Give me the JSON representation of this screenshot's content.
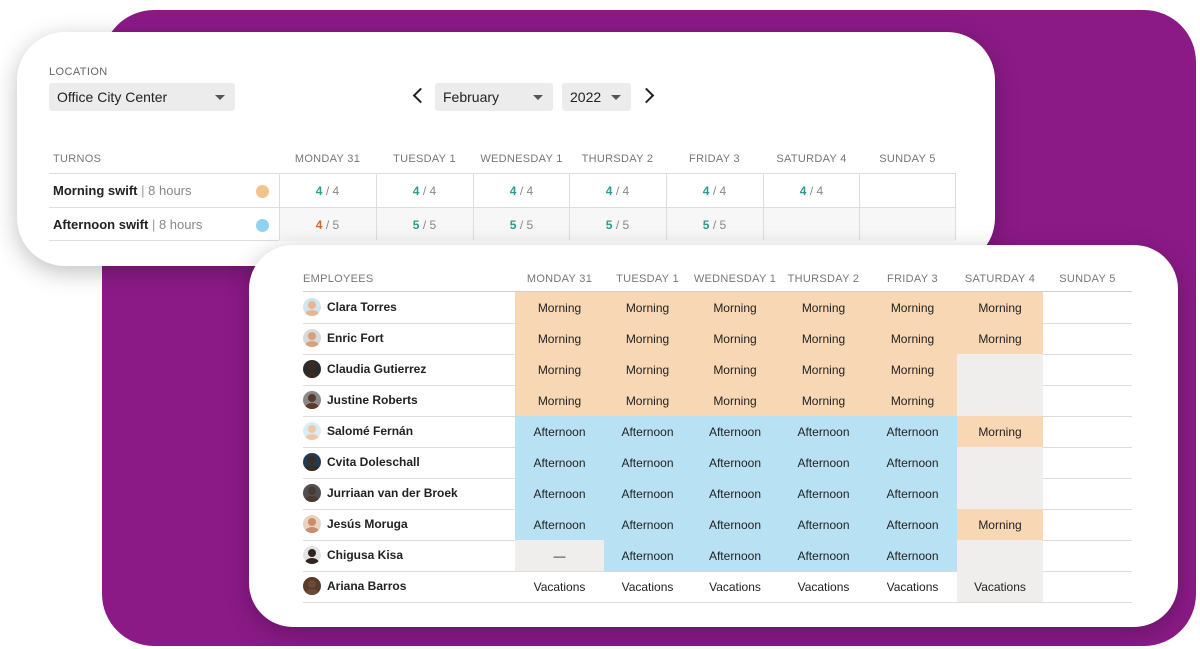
{
  "colors": {
    "morning": "#f8d7b4",
    "afternoon": "#b8e2f4",
    "morning_dot": "#f1c48e",
    "afternoon_dot": "#8fd2ef",
    "accent_green": "#2a9d8f",
    "accent_orange": "#d2691e",
    "brand_bg": "#8b1a87"
  },
  "location": {
    "label": "LOCATION",
    "value": "Office City Center"
  },
  "period": {
    "month": "February",
    "year": "2022"
  },
  "shifts": {
    "header": "TURNOS",
    "days": [
      "MONDAY 31",
      "TUESDAY 1",
      "WEDNESDAY 1",
      "THURSDAY 2",
      "FRIDAY 3",
      "SATURDAY 4",
      "SUNDAY 5"
    ],
    "rows": [
      {
        "name": "Morning swift",
        "sep": "|",
        "hours": "8 hours",
        "counts": [
          {
            "assigned": "4",
            "slash": "/",
            "total": "4",
            "status": "ok"
          },
          {
            "assigned": "4",
            "slash": "/",
            "total": "4",
            "status": "ok"
          },
          {
            "assigned": "4",
            "slash": "/",
            "total": "4",
            "status": "ok"
          },
          {
            "assigned": "4",
            "slash": "/",
            "total": "4",
            "status": "ok"
          },
          {
            "assigned": "4",
            "slash": "/",
            "total": "4",
            "status": "ok"
          },
          {
            "assigned": "4",
            "slash": "/",
            "total": "4",
            "status": "ok"
          },
          null
        ]
      },
      {
        "name": "Afternoon swift",
        "sep": "|",
        "hours": "8 hours",
        "counts": [
          {
            "assigned": "4",
            "slash": "/",
            "total": "5",
            "status": "short"
          },
          {
            "assigned": "5",
            "slash": "/",
            "total": "5",
            "status": "ok"
          },
          {
            "assigned": "5",
            "slash": "/",
            "total": "5",
            "status": "ok"
          },
          {
            "assigned": "5",
            "slash": "/",
            "total": "5",
            "status": "ok"
          },
          {
            "assigned": "5",
            "slash": "/",
            "total": "5",
            "status": "ok"
          },
          null,
          null
        ]
      }
    ]
  },
  "employees": {
    "header": "EMPLOYEES",
    "days": [
      "MONDAY 31",
      "TUESDAY 1",
      "WEDNESDAY 1",
      "THURSDAY 2",
      "FRIDAY 3",
      "SATURDAY 4",
      "SUNDAY 5"
    ],
    "rows": [
      {
        "name": "Clara Torres",
        "cells": [
          "Morning",
          "Morning",
          "Morning",
          "Morning",
          "Morning",
          "Morning",
          ""
        ],
        "types": [
          "m",
          "m",
          "m",
          "m",
          "m",
          "m",
          "n"
        ]
      },
      {
        "name": "Enric Fort",
        "cells": [
          "Morning",
          "Morning",
          "Morning",
          "Morning",
          "Morning",
          "Morning",
          ""
        ],
        "types": [
          "m",
          "m",
          "m",
          "m",
          "m",
          "m",
          "n"
        ]
      },
      {
        "name": "Claudia Gutierrez",
        "cells": [
          "Morning",
          "Morning",
          "Morning",
          "Morning",
          "Morning",
          "",
          ""
        ],
        "types": [
          "m",
          "m",
          "m",
          "m",
          "m",
          "o",
          "n"
        ]
      },
      {
        "name": "Justine Roberts",
        "cells": [
          "Morning",
          "Morning",
          "Morning",
          "Morning",
          "Morning",
          "",
          ""
        ],
        "types": [
          "m",
          "m",
          "m",
          "m",
          "m",
          "o",
          "n"
        ]
      },
      {
        "name": "Salomé Fernán",
        "cells": [
          "Afternoon",
          "Afternoon",
          "Afternoon",
          "Afternoon",
          "Afternoon",
          "Morning",
          ""
        ],
        "types": [
          "a",
          "a",
          "a",
          "a",
          "a",
          "m",
          "n"
        ]
      },
      {
        "name": "Cvita Doleschall",
        "cells": [
          "Afternoon",
          "Afternoon",
          "Afternoon",
          "Afternoon",
          "Afternoon",
          "",
          ""
        ],
        "types": [
          "a",
          "a",
          "a",
          "a",
          "a",
          "o",
          "n"
        ]
      },
      {
        "name": "Jurriaan van der Broek",
        "cells": [
          "Afternoon",
          "Afternoon",
          "Afternoon",
          "Afternoon",
          "Afternoon",
          "",
          ""
        ],
        "types": [
          "a",
          "a",
          "a",
          "a",
          "a",
          "o",
          "n"
        ]
      },
      {
        "name": "Jesús Moruga",
        "cells": [
          "Afternoon",
          "Afternoon",
          "Afternoon",
          "Afternoon",
          "Afternoon",
          "Morning",
          ""
        ],
        "types": [
          "a",
          "a",
          "a",
          "a",
          "a",
          "m",
          "n"
        ]
      },
      {
        "name": "Chigusa Kisa",
        "cells": [
          "—",
          "Afternoon",
          "Afternoon",
          "Afternoon",
          "Afternoon",
          "",
          ""
        ],
        "types": [
          "o",
          "a",
          "a",
          "a",
          "a",
          "o",
          "n"
        ]
      },
      {
        "name": "Ariana Barros",
        "cells": [
          "Vacations",
          "Vacations",
          "Vacations",
          "Vacations",
          "Vacations",
          "Vacations",
          ""
        ],
        "types": [
          "n",
          "n",
          "n",
          "n",
          "n",
          "o",
          "n"
        ]
      }
    ]
  }
}
